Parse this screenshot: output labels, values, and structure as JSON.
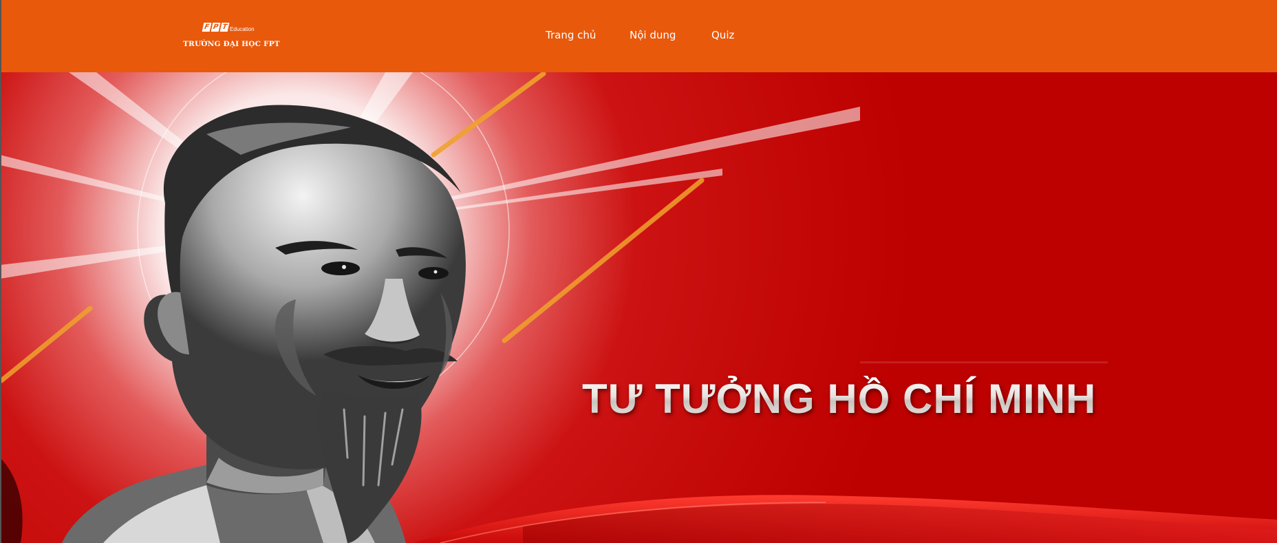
{
  "header": {
    "brand_color": "#e8590c",
    "logo": {
      "mark_letters": [
        "F",
        "P",
        "T"
      ],
      "sublabel": "Education",
      "name": "TRƯỜNG ĐẠI HỌC FPT"
    },
    "nav": [
      {
        "label": "Trang chủ"
      },
      {
        "label": "Nội dung"
      },
      {
        "label": "Quiz"
      }
    ]
  },
  "hero": {
    "title": "TƯ TƯỞNG HỒ CHÍ MINH",
    "background_color": "#c00000",
    "image": "portrait-illustration"
  }
}
